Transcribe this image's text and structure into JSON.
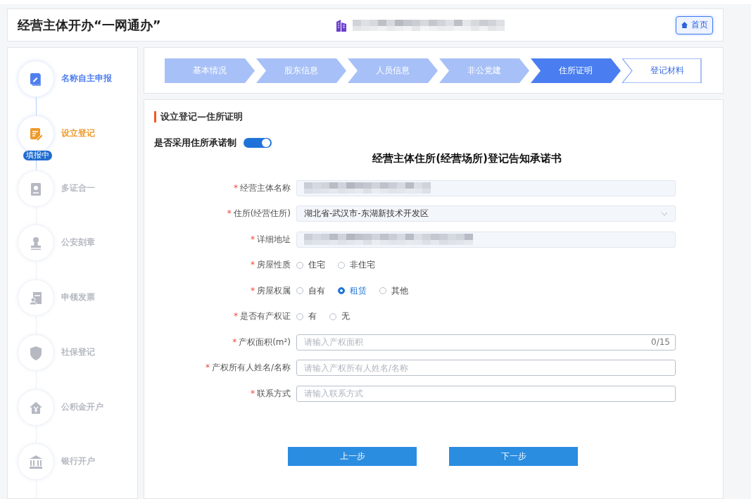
{
  "header": {
    "title": "经营主体开办“一网通办”",
    "home_button": "首页"
  },
  "sidebar": {
    "items": [
      {
        "label": "名称自主申报",
        "completed": true,
        "selected": false
      },
      {
        "label": "设立登记",
        "selected": true,
        "badge": "填报中"
      },
      {
        "label": "多证合一",
        "completed": false,
        "selected": false
      },
      {
        "label": "公安刻章",
        "completed": false,
        "selected": false
      },
      {
        "label": "申领发票",
        "completed": false,
        "selected": false
      },
      {
        "label": "社保登记",
        "completed": false,
        "selected": false
      },
      {
        "label": "公积金开户",
        "completed": false,
        "selected": false
      },
      {
        "label": "银行开户",
        "completed": false,
        "selected": false
      }
    ]
  },
  "steps": [
    {
      "label": "基本情况",
      "completed": true,
      "selected": false
    },
    {
      "label": "股东信息",
      "completed": true,
      "selected": false
    },
    {
      "label": "人员信息",
      "completed": true,
      "selected": false
    },
    {
      "label": "非公党建",
      "completed": true,
      "selected": false
    },
    {
      "label": "住所证明",
      "selected": true
    },
    {
      "label": "登记材料",
      "completed": false,
      "selected": false
    }
  ],
  "form": {
    "section_title": "设立登记—住所证明",
    "toggle": {
      "label": "是否采用住所承诺制",
      "on": true
    },
    "heading": "经营主体住所(经营场所)登记告知承诺书",
    "fields": [
      {
        "kind": "redacted",
        "mark": "*",
        "label": "经营主体名称"
      },
      {
        "kind": "select",
        "mark": "*",
        "label": "住所(经营住所)",
        "value": "湖北省-武汉市-东湖新技术开发区"
      },
      {
        "kind": "redacted",
        "mark": "*",
        "label": "详细地址"
      },
      {
        "kind": "radio",
        "mark": "*",
        "label": "房屋性质",
        "options": [
          {
            "label": "住宅",
            "selected": false
          },
          {
            "label": "非住宅",
            "selected": false
          }
        ]
      },
      {
        "kind": "radio",
        "mark": "*",
        "label": "房屋权属",
        "options": [
          {
            "label": "自有",
            "selected": false
          },
          {
            "label": "租赁",
            "selected": true
          },
          {
            "label": "其他",
            "selected": false
          }
        ]
      },
      {
        "kind": "radio",
        "mark": "*",
        "label": "是否有产权证",
        "options": [
          {
            "label": "有",
            "selected": false
          },
          {
            "label": "无",
            "selected": false
          }
        ]
      },
      {
        "kind": "input",
        "mark": "*",
        "label": "产权面积(m²)",
        "placeholder": "请输入产权面积",
        "counter": "0/15"
      },
      {
        "kind": "input",
        "mark": "*",
        "label": "产权所有人姓名/名称",
        "placeholder": "请输入产权所有人姓名/名称"
      },
      {
        "kind": "input",
        "mark": "*",
        "label": "联系方式",
        "placeholder": "请输入联系方式"
      }
    ],
    "buttons": [
      "上一步",
      "下一步"
    ]
  }
}
